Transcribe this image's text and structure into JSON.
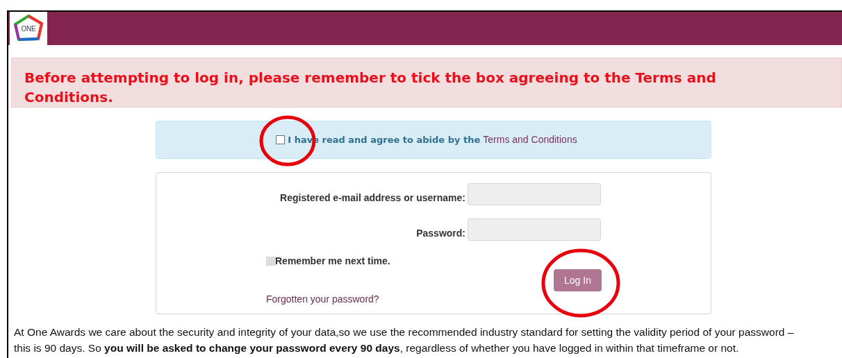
{
  "header": {
    "logo_text": "ONE"
  },
  "alert": {
    "message": "Before attempting to log in, please remember to tick the box agreeing to the Terms and Conditions."
  },
  "terms": {
    "checked": false,
    "label": "I have read and agree to abide by the",
    "link": "Terms and Conditions"
  },
  "login_form": {
    "fields": [
      {
        "label": "Registered e-mail address or username:"
      },
      {
        "label": "Password:"
      }
    ],
    "remember": {
      "label": "Remember me next time.",
      "checked": false
    },
    "button": "Log In",
    "forgot_link": "Forgotten your password?"
  },
  "notice": "At One Awards we care about the security and integrity of your data,so we use the recommended industry standard for setting the validity period of your password – this is 90 days.  So **you will be asked to change your password every 90 days**, regardless of whether you have logged in within that timeframe or not."
}
